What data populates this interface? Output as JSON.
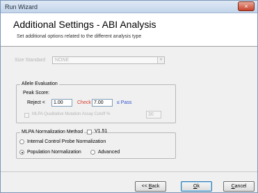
{
  "window": {
    "title": "Run Wizard",
    "close_glyph": "×"
  },
  "header": {
    "title": "Additional Settings - ABI Analysis",
    "subtitle": "Set additional options related to the different analysis type"
  },
  "size_standard": {
    "label": "Size Standard",
    "value": "NONE",
    "arrow": "▾"
  },
  "allele_evaluation": {
    "title": "Allele Evaluation",
    "peak_score_label": "Peak Score:",
    "reject_label": "Reject <",
    "reject_value": "1.00",
    "check_label": "Check",
    "pass_value": "7.00",
    "pass_label": "≤ Pass",
    "mutation_label": "MLPA Qualitative Mutation Assay Cutoff %",
    "mutation_value": "30"
  },
  "mlpa": {
    "title": "MLPA Normalization Method",
    "v151_label": "V1.51",
    "internal_label": "Internal Control Probe Normalization",
    "population_label": "Population Normalization",
    "advanced_label": "Advanced"
  },
  "buttons": {
    "back_prefix": "<< ",
    "back_mnemonic": "B",
    "back_rest": "ack",
    "ok_mnemonic": "O",
    "ok_rest": "k",
    "cancel_mnemonic": "C",
    "cancel_rest": "ancel"
  },
  "colors": {
    "check_label": "#d63a2a",
    "pass_label": "#2f4fcf",
    "close_button": "#c7432c"
  }
}
